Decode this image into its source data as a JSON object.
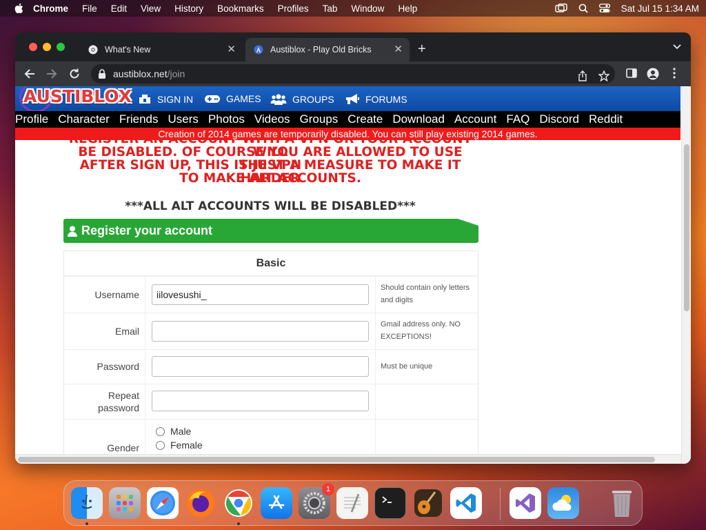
{
  "menubar": {
    "app_name": "Chrome",
    "items": [
      "File",
      "Edit",
      "View",
      "History",
      "Bookmarks",
      "Profiles",
      "Tab",
      "Window",
      "Help"
    ],
    "clock": "Sat Jul 15  1:34 AM"
  },
  "browser": {
    "tabs": [
      {
        "title": "What's New",
        "icon": "chrome-icon",
        "active": false
      },
      {
        "title": "Austiblox - Play Old Bricks",
        "icon": "austiblox-favicon",
        "active": true
      }
    ],
    "url_host": "austiblox.net",
    "url_path": "/join"
  },
  "site": {
    "logo": "AUSTIBLOX",
    "header_nav": [
      {
        "label": "SIGN IN",
        "icon": "sign-in-icon"
      },
      {
        "label": "GAMES",
        "icon": "gamepad-icon"
      },
      {
        "label": "GROUPS",
        "icon": "users-icon"
      },
      {
        "label": "FORUMS",
        "icon": "megaphone-icon"
      }
    ],
    "sub_nav": [
      "Profile",
      "Character",
      "Friends",
      "Users",
      "Photos",
      "Videos",
      "Groups",
      "Create",
      "Download",
      "Account",
      "FAQ",
      "Discord",
      "Reddit"
    ],
    "alert": "Creation of 2014 games are temporarily disabled. You can still play existing 2014 games.",
    "warning_lines": [
      "REGISTER AN ACCOUNT WITH A VPN OR YOUR ACCOUNT WILL",
      "BE DISABLED. OF COURSE YOU ARE ALLOWED TO USE THE VPN",
      "AFTER SIGN UP, THIS IS JUST A MEASURE TO MAKE IT HARDER",
      "TO MAKE ALT ACCOUNTS."
    ],
    "alt_warning": "***ALL ALT ACCOUNTS WILL BE DISABLED***",
    "register_title": "Register your account",
    "form": {
      "section_title": "Basic",
      "username": {
        "label": "Username",
        "value": "iilovesushi_",
        "hint": "Should contain only letters and digits"
      },
      "email": {
        "label": "Email",
        "value": "",
        "hint": "Gmail address only. NO EXCEPTIONS!"
      },
      "password": {
        "label": "Password",
        "value": "",
        "hint": "Must be unique"
      },
      "repeat_password": {
        "label": "Repeat password",
        "value": ""
      },
      "gender": {
        "label": "Gender",
        "options": [
          "Male",
          "Female"
        ]
      }
    }
  },
  "dock": {
    "apps": [
      "Finder",
      "Launchpad",
      "Safari",
      "Firefox",
      "Google Chrome",
      "App Store",
      "System Settings",
      "TextEdit",
      "Terminal",
      "GarageBand",
      "Visual Studio Code",
      "Visual Studio",
      "Weather",
      "Trash"
    ],
    "system_settings_badge": "1"
  }
}
